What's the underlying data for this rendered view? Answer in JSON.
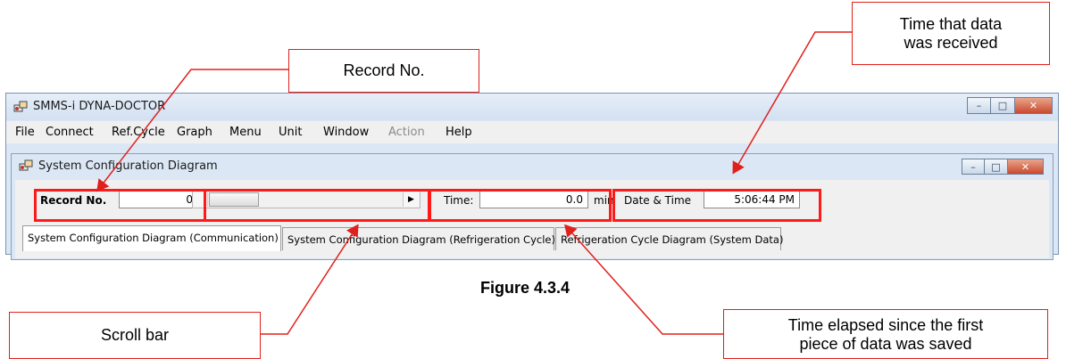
{
  "callouts": {
    "record_no": "Record No.",
    "time_received_line1": "Time that data",
    "time_received_line2": "was received",
    "scroll_bar": "Scroll bar",
    "elapsed_line1": "Time elapsed since the first",
    "elapsed_line2": "piece of data was saved"
  },
  "figure_caption": "Figure 4.3.4",
  "app": {
    "title": "SMMS-i DYNA-DOCTOR",
    "menu": [
      "File",
      "Connect",
      "Ref.Cycle",
      "Graph",
      "Menu",
      "Unit",
      "Window",
      "Action",
      "Help"
    ],
    "disabled_menu": "Action"
  },
  "window_controls": {
    "minimize": "–",
    "maximize": "□",
    "close": "✕"
  },
  "child_window": {
    "title": "System Configuration Diagram",
    "record_label": "Record No.",
    "record_value": "0",
    "time_label": "Time:",
    "time_value": "0.0",
    "time_unit": "min",
    "datetime_label": "Date & Time",
    "datetime_value": "5:06:44 PM",
    "tabs": [
      "System Configuration Diagram (Communication)",
      "System Configuration Diagram (Refrigeration Cycle)",
      "Refrigeration Cycle Diagram (System Data)"
    ]
  },
  "icons": [
    "app-icon",
    "child-window-icon",
    "scroll-right-arrow-icon"
  ],
  "colors": {
    "highlight": "#ff1a1a",
    "callout_border": "#e0201c",
    "title_bar": "#d3e1f2"
  }
}
